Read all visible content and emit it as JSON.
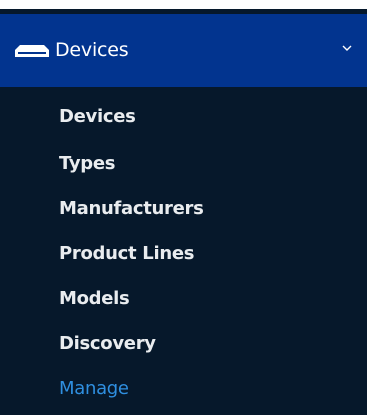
{
  "sidebar": {
    "group": {
      "label": "Devices",
      "icon": "device-icon",
      "toggle_icon": "chevron-down-icon",
      "expanded": true
    },
    "items": [
      {
        "label": "Devices",
        "active": false
      },
      {
        "label": "Types",
        "active": false
      },
      {
        "label": "Manufacturers",
        "active": false
      },
      {
        "label": "Product Lines",
        "active": false
      },
      {
        "label": "Models",
        "active": false
      },
      {
        "label": "Discovery",
        "active": false
      },
      {
        "label": "Manage",
        "active": true
      }
    ],
    "colors": {
      "background": "#06182b",
      "header_background": "#02348f",
      "text": "#e9ecef",
      "active_text": "#2f8fe0"
    }
  }
}
